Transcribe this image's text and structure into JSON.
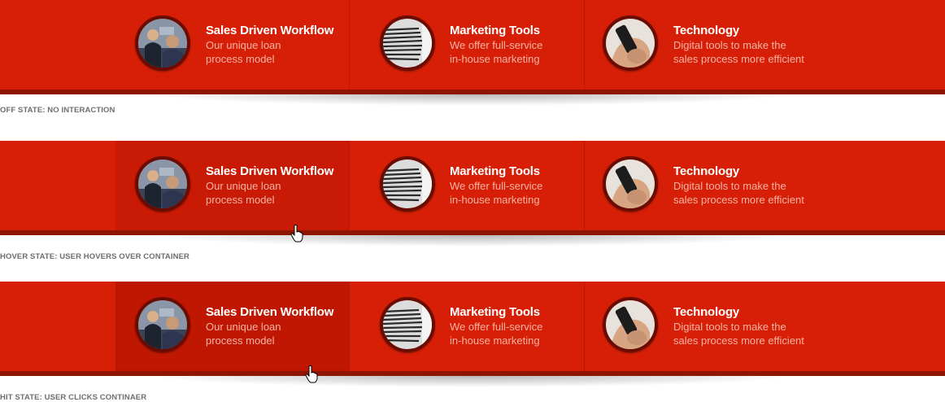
{
  "items": [
    {
      "title": "Sales Driven Workflow",
      "desc_line1": "Our unique loan",
      "desc_line2": "process model",
      "icon": "meeting-photo-icon"
    },
    {
      "title": "Marketing Tools",
      "desc_line1": "We offer full-service",
      "desc_line2": "in-house marketing",
      "icon": "binder-pages-icon"
    },
    {
      "title": "Technology",
      "desc_line1": "Digital tools to make the",
      "desc_line2": "sales process more efficient",
      "icon": "smartphone-hand-icon"
    }
  ],
  "states": [
    {
      "caption": "OFF STATE: NO INTERACTION"
    },
    {
      "caption": "HOVER STATE: USER HOVERS OVER CONTAINER"
    },
    {
      "caption": "HIT STATE: USER CLICKS CONTINAER"
    }
  ],
  "colors": {
    "band": "#d61f06",
    "band_bottom": "#8e1404",
    "hover": "#c81a04",
    "description": "#f6b3a3"
  }
}
